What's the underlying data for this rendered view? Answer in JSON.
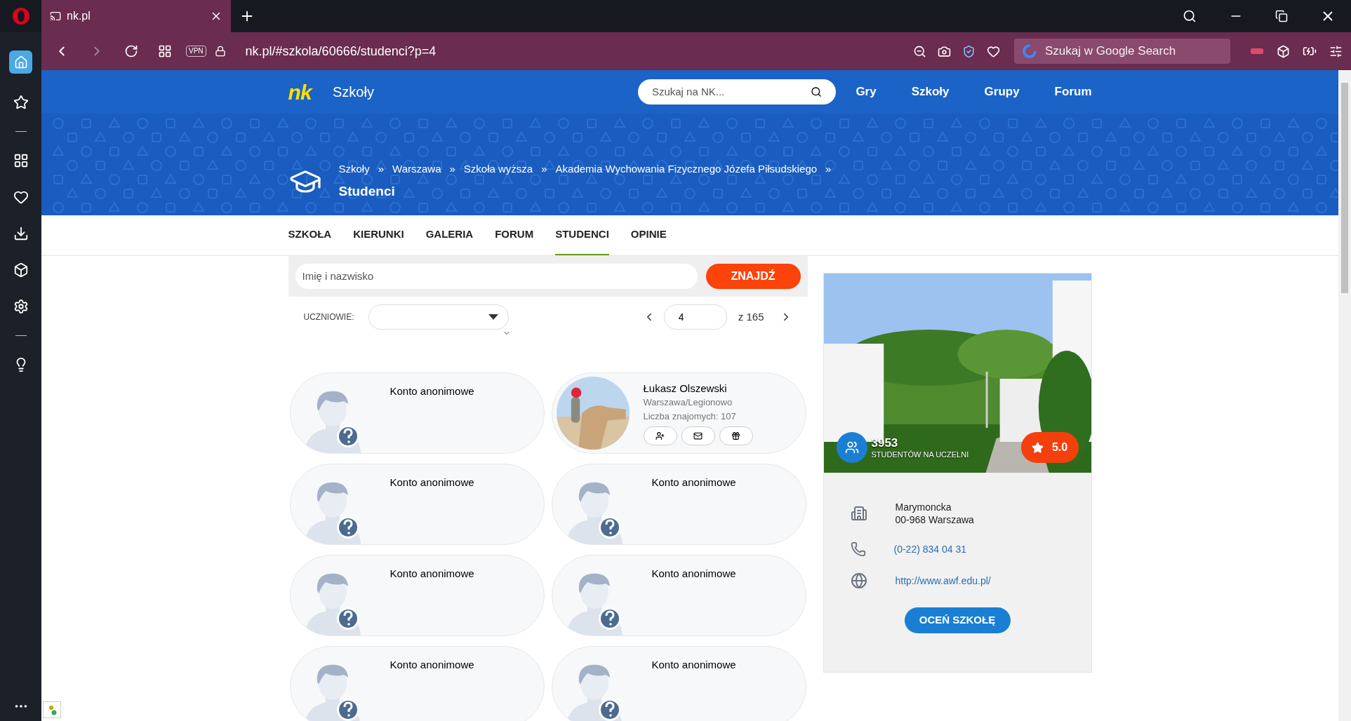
{
  "browser": {
    "tab_title": "nk.pl",
    "vpn": "VPN",
    "address": "nk.pl/#szkola/60666/studenci?p=4",
    "search_placeholder": "Szukaj w Google Search"
  },
  "site_header": {
    "logo": "nk",
    "section": "Szkoły",
    "search_placeholder": "Szukaj na NK...",
    "nav": [
      "Gry",
      "Szkoły",
      "Grupy",
      "Forum"
    ]
  },
  "banner": {
    "breadcrumbs": [
      {
        "label": "Szkoły",
        "separator": "»"
      },
      {
        "label": "Warszawa",
        "separator": "»"
      },
      {
        "label": "Szkoła wyższa",
        "separator": "»"
      },
      {
        "label": "Akademia Wychowania Fizycznego Józefa Piłsudskiego",
        "separator": "»"
      }
    ],
    "title": "Studenci"
  },
  "tabs": [
    {
      "label": "SZKOŁA",
      "selected": false
    },
    {
      "label": "KIERUNKI",
      "selected": false
    },
    {
      "label": "GALERIA",
      "selected": false
    },
    {
      "label": "FORUM",
      "selected": false
    },
    {
      "label": "STUDENCI",
      "selected": true
    },
    {
      "label": "OPINIE",
      "selected": false
    }
  ],
  "search": {
    "placeholder": "Imię i nazwisko",
    "button": "ZNAJDŹ"
  },
  "filter": {
    "label": "UCZNIOWIE:"
  },
  "pagination": {
    "page": "4",
    "total": "z 165"
  },
  "students": [
    {
      "kind": "anonymous",
      "name": "Konto anonimowe"
    },
    {
      "kind": "profile",
      "name": "Łukasz Olszewski",
      "location": "Warszawa/Legionowo",
      "friends": "Liczba znajomych: 107"
    },
    {
      "kind": "anonymous",
      "name": "Konto anonimowe"
    },
    {
      "kind": "anonymous",
      "name": "Konto anonimowe"
    },
    {
      "kind": "anonymous",
      "name": "Konto anonimowe"
    },
    {
      "kind": "anonymous",
      "name": "Konto anonimowe"
    },
    {
      "kind": "anonymous",
      "name": "Konto anonimowe"
    },
    {
      "kind": "anonymous",
      "name": "Konto anonimowe"
    }
  ],
  "school": {
    "students_count": "3953",
    "students_label": "STUDENTÓW NA UCZELNI",
    "rating": "5.0",
    "address": [
      "Marymoncka",
      "00-968 Warszawa"
    ],
    "phone": "(0-22) 834 04 31",
    "website": "http://www.awf.edu.pl/",
    "rate_button": "OCEŃ SZKOŁĘ"
  }
}
